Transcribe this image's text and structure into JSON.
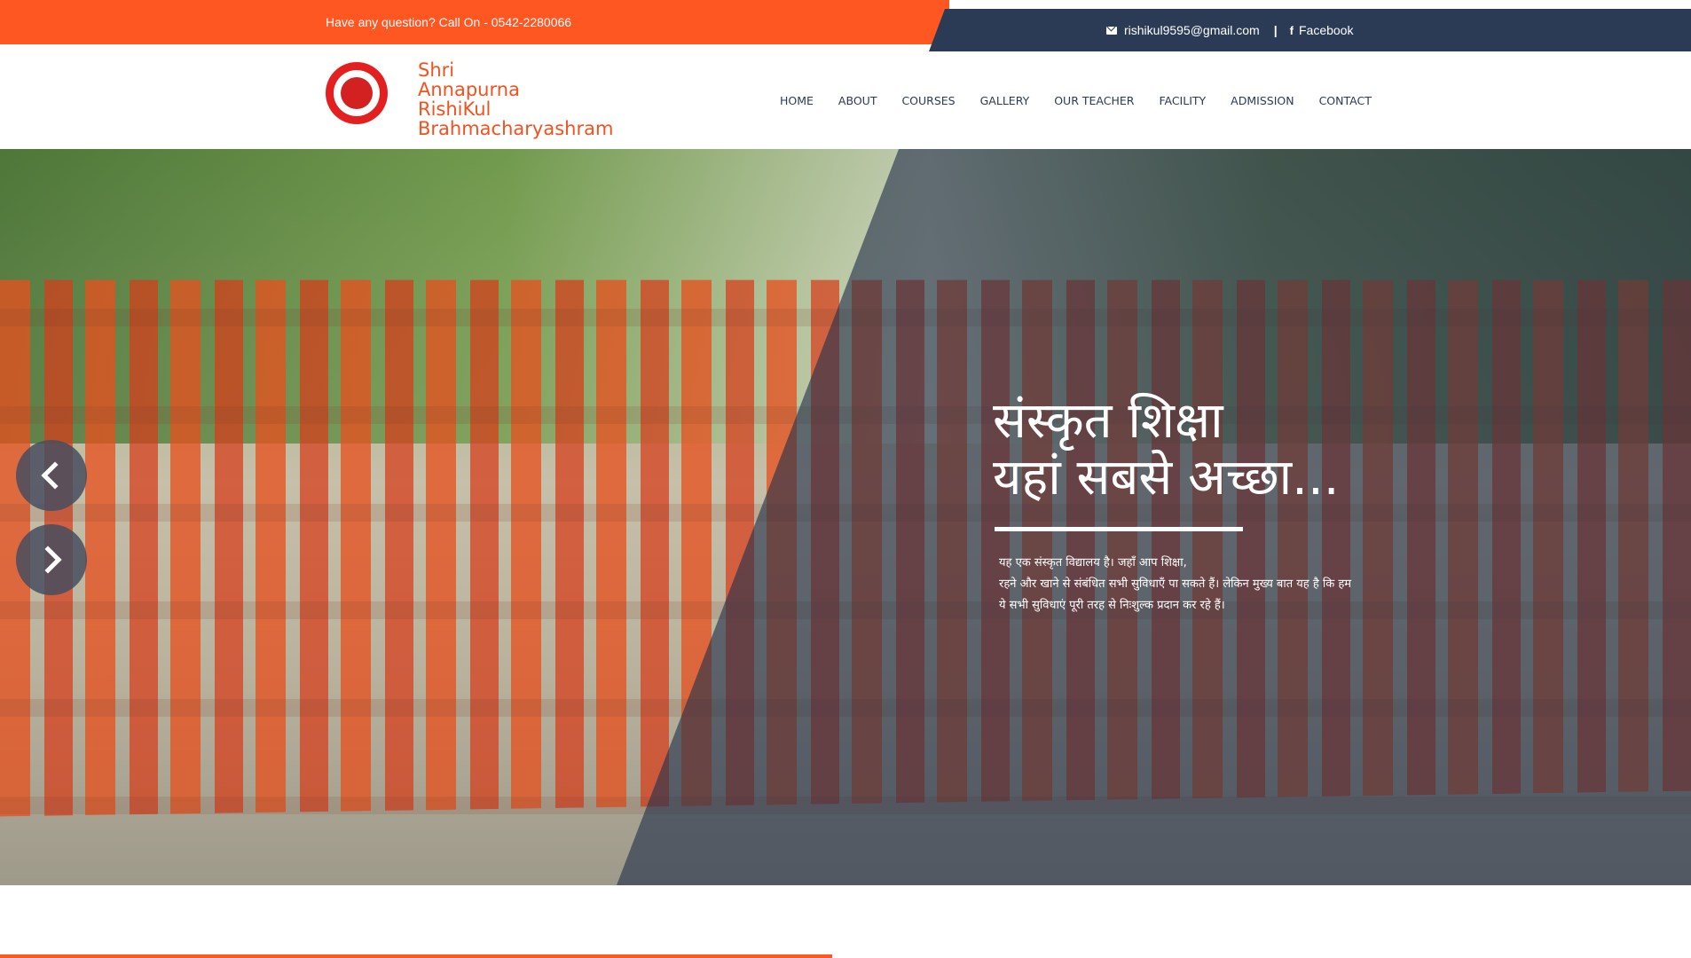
{
  "topbar": {
    "question": "Have any question? Call On - 0542-2280066",
    "email": "rishikul9595@gmail.com",
    "separator": "|",
    "facebook_icon": "f",
    "facebook": "Facebook"
  },
  "brand": {
    "logo_icon": "school-seal-logo",
    "line1": "Shri",
    "line2": "Annapurna",
    "line3": "RishiKul",
    "line4": "Brahmacharyashram"
  },
  "nav": {
    "items": [
      "HOME",
      "ABOUT",
      "COURSES",
      "GALLERY",
      "OUR TEACHER",
      "FACILITY",
      "ADMISSION",
      "CONTACT"
    ]
  },
  "hero": {
    "title_line1": "संस्कृत शिक्षा",
    "title_line2": "यहां सबसे अच्छा...",
    "text_line1": "यह एक संस्कृत विद्यालय है। जहाँ आप शिक्षा,",
    "text_line2": "रहने और खाने से संबंधित सभी सुविधाएँ पा सकते हैं। लेकिन मुख्य बात यह है कि हम",
    "text_line3": "ये सभी सुविधाएं पूरी तरह से निःशुल्क प्रदान कर रहे हैं।",
    "prev_icon": "chevron-left-icon",
    "next_icon": "chevron-right-icon"
  },
  "colors": {
    "accent": "#ff5722",
    "dark": "#2b3a55",
    "brand_text": "#f4511e"
  }
}
